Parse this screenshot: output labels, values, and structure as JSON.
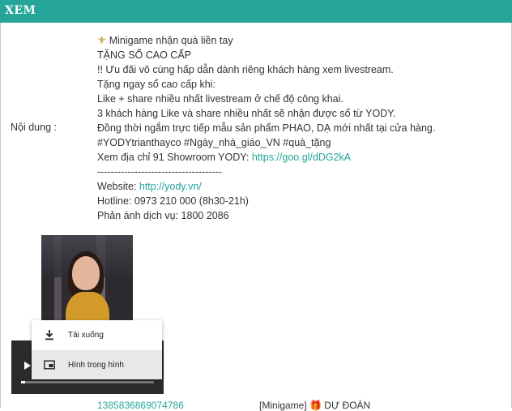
{
  "window": {
    "title": "XEM"
  },
  "field": {
    "label": "Nội dung :"
  },
  "content": {
    "lines": [
      "Minigame nhận quà liền tay",
      "TẶNG SỔ CAO CẤP",
      "!! Ưu đãi vô cùng hấp dẫn dành riêng khách hàng xem livestream.",
      "Tặng ngay sổ cao cấp khi:",
      "Like + share nhiều nhất livestream ở chế độ công khai.",
      "3 khách hàng Like và share nhiều nhất sẽ nhận được sổ từ YODY.",
      "Đồng thời ngắm trực tiếp mẫu sản phẩm PHAO, DẠ mới nhất tại cửa hàng.",
      "#YODYtrianthayco #Ngày_nhà_giáo_VN #quà_tặng"
    ],
    "address_prefix": "Xem địa chỉ 91 Showroom YODY: ",
    "address_link": "https://goo.gl/dDG2kA",
    "divider": "-------------------------------------",
    "website_prefix": "Website: ",
    "website_link": "http://yody.vn/",
    "hotline": "Hotline: 0973 210 000 (8h30-21h)",
    "feedback": "Phản ánh dịch vụ: 1800 2086",
    "fleur_icon": "fleur-de-lis-icon"
  },
  "video": {
    "progress": 0.03
  },
  "context_menu": {
    "items": [
      {
        "label": "Tải xuống",
        "icon": "download-icon"
      },
      {
        "label": "Hình trong hình",
        "icon": "picture-in-picture-icon"
      }
    ]
  },
  "below": {
    "link_fragment": "1385836869074786",
    "text_fragment": "[Minigame] 🎁 DỰ ĐOÁN"
  },
  "colors": {
    "accent": "#26a69a"
  }
}
